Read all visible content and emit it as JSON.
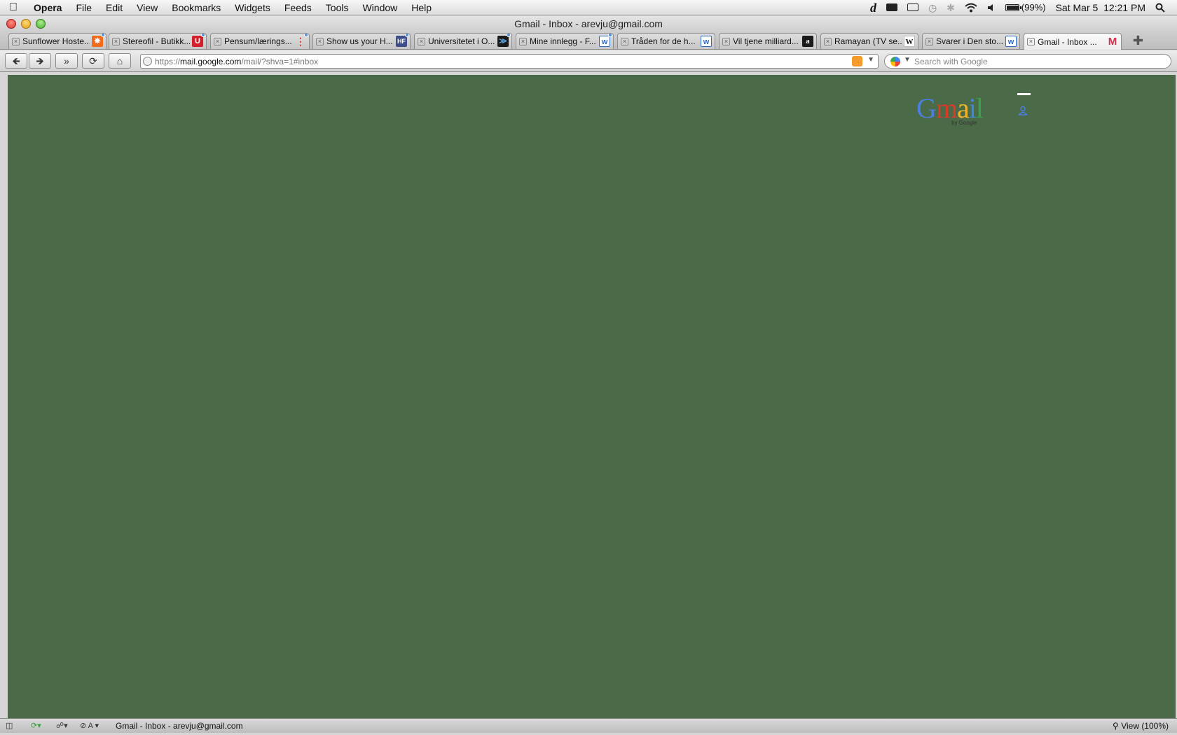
{
  "menubar": {
    "items": [
      "Opera",
      "File",
      "Edit",
      "View",
      "Bookmarks",
      "Widgets",
      "Feeds",
      "Tools",
      "Window",
      "Help"
    ],
    "tray_d": "d",
    "battery": "(99%)",
    "battery_level": 0.99,
    "clock": "Sat Mar 5  12:21 PM"
  },
  "window": {
    "title": "Gmail - Inbox - arevju@gmail.com"
  },
  "tabs": [
    {
      "label": "Sunflower Hoste...",
      "fav_color": "#f26b1d",
      "fav_text": ""
    },
    {
      "label": "Stereofil - Butikk...",
      "fav_color": "#d4202a",
      "fav_text": "U"
    },
    {
      "label": "Pensum/lærings...",
      "fav_color": "#e8332b",
      "fav_text": ""
    },
    {
      "label": "Show us your H...",
      "fav_color": "#3d4f8a",
      "fav_text": "HF"
    },
    {
      "label": "Universitetet i O...",
      "fav_color": "#1a1a1a",
      "fav_text": ""
    },
    {
      "label": "Mine innlegg - F...",
      "fav_color": "#2f6cc1",
      "fav_text": ""
    },
    {
      "label": "Tråden for de h...",
      "fav_color": "#2f6cc1",
      "fav_text": ""
    },
    {
      "label": "Vil tjene milliard...",
      "fav_color": "#1a1a1a",
      "fav_text": ""
    },
    {
      "label": "Ramayan (TV se...",
      "fav_color": "#ffffff",
      "fav_text": "W"
    },
    {
      "label": "Svarer i Den sto...",
      "fav_color": "#2f6cc1",
      "fav_text": ""
    },
    {
      "label": "Gmail - Inbox ...",
      "fav_color": "#ffffff",
      "fav_text": "M"
    }
  ],
  "address": {
    "scheme": "https://",
    "host": "mail.google.com",
    "path": "/mail/?shva=1#inbox",
    "search_placeholder": "Search with Google"
  },
  "gmail": {
    "logo_letters": [
      "G",
      "m",
      "a",
      "i",
      "l"
    ],
    "by_google": "by Google"
  },
  "statusbar": {
    "text": "Gmail - Inbox - arevju@gmail.com",
    "zoom": "View (100%)"
  },
  "colors": {
    "content_bg": "#4b6a47"
  }
}
